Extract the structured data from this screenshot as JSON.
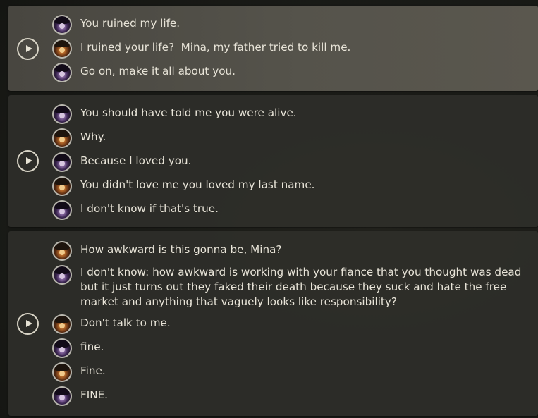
{
  "panels": [
    {
      "active": true,
      "lines": [
        {
          "speaker": "mina",
          "text": "You ruined my life."
        },
        {
          "speaker": "other",
          "text": "I ruined your life?  Mina, my father tried to kill me."
        },
        {
          "speaker": "mina",
          "text": "Go on, make it all about you."
        }
      ]
    },
    {
      "active": false,
      "lines": [
        {
          "speaker": "mina",
          "text": "You should have told me you were alive."
        },
        {
          "speaker": "other",
          "text": "Why."
        },
        {
          "speaker": "mina",
          "text": "Because I loved you."
        },
        {
          "speaker": "other",
          "text": "You didn't love me you loved my last name."
        },
        {
          "speaker": "mina",
          "text": "I don't know if that's true."
        }
      ]
    },
    {
      "active": false,
      "lines": [
        {
          "speaker": "other",
          "text": "How awkward is this gonna be, Mina?"
        },
        {
          "speaker": "mina",
          "text": "I don't know: how awkward is working with your fiance that you thought was dead but it just turns out they faked their death because they suck and hate the free market and anything that vaguely looks like responsibility?"
        },
        {
          "speaker": "other",
          "text": "Don't talk to me."
        },
        {
          "speaker": "mina",
          "text": "fine."
        },
        {
          "speaker": "other",
          "text": "Fine."
        },
        {
          "speaker": "mina",
          "text": "FINE."
        }
      ]
    }
  ]
}
